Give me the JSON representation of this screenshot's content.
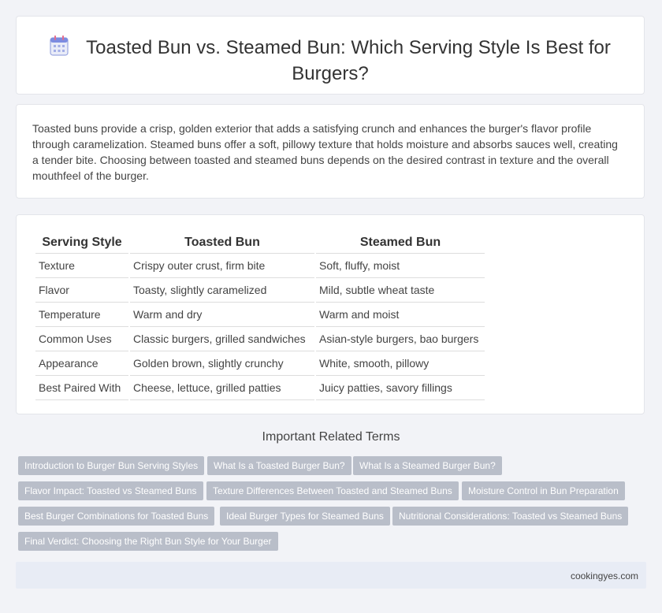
{
  "header": {
    "icon": "calendar-icon",
    "title": "Toasted Bun vs. Steamed Bun: Which Serving Style Is Best for Burgers?"
  },
  "intro": "Toasted buns provide a crisp, golden exterior that adds a satisfying crunch and enhances the burger's flavor profile through caramelization. Steamed buns offer a soft, pillowy texture that holds moisture and absorbs sauces well, creating a tender bite. Choosing between toasted and steamed buns depends on the desired contrast in texture and the overall mouthfeel of the burger.",
  "table": {
    "headers": [
      "Serving Style",
      "Toasted Bun",
      "Steamed Bun"
    ],
    "rows": [
      [
        "Texture",
        "Crispy outer crust, firm bite",
        "Soft, fluffy, moist"
      ],
      [
        "Flavor",
        "Toasty, slightly caramelized",
        "Mild, subtle wheat taste"
      ],
      [
        "Temperature",
        "Warm and dry",
        "Warm and moist"
      ],
      [
        "Common Uses",
        "Classic burgers, grilled sandwiches",
        "Asian-style burgers, bao burgers"
      ],
      [
        "Appearance",
        "Golden brown, slightly crunchy",
        "White, smooth, pillowy"
      ],
      [
        "Best Paired With",
        "Cheese, lettuce, grilled patties",
        "Juicy patties, savory fillings"
      ]
    ]
  },
  "related": {
    "title": "Important Related Terms",
    "tags": [
      "Introduction to Burger Bun Serving Styles",
      "What Is a Toasted Burger Bun?",
      "What Is a Steamed Burger Bun?",
      "Flavor Impact: Toasted vs Steamed Buns",
      "Texture Differences Between Toasted and Steamed Buns",
      "Moisture Control in Bun Preparation",
      "Best Burger Combinations for Toasted Buns",
      "Ideal Burger Types for Steamed Buns",
      "Nutritional Considerations: Toasted vs Steamed Buns",
      "Final Verdict: Choosing the Right Bun Style for Your Burger"
    ]
  },
  "footer": {
    "site": "cookingyes.com"
  }
}
